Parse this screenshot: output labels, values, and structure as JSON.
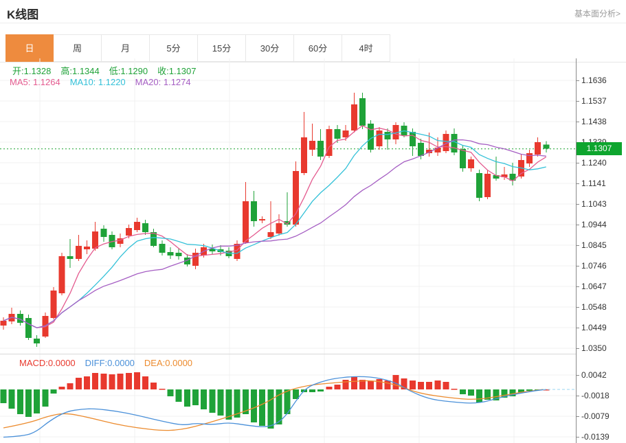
{
  "header": {
    "title": "K线图",
    "link": "基本面分析>"
  },
  "tabs": {
    "items": [
      {
        "label": "日",
        "selected": true
      },
      {
        "label": "周"
      },
      {
        "label": "月"
      },
      {
        "label": "5分"
      },
      {
        "label": "15分"
      },
      {
        "label": "30分"
      },
      {
        "label": "60分"
      },
      {
        "label": "4时"
      }
    ]
  },
  "legend": {
    "ohlc_items": [
      "开:1.1328",
      "高:1.1344",
      "低:1.1290",
      "收:1.1307"
    ],
    "ma_items": [
      "MA5: 1.1264",
      "MA10: 1.1220",
      "MA20: 1.1274"
    ],
    "macd_items": [
      "MACD:0.0000",
      "DIFF:0.0000",
      "DEA:0.0000"
    ]
  },
  "chart_data": {
    "type": "candlestick+macd",
    "main": {
      "y_ticks": [
        "1.1636",
        "1.1537",
        "1.1438",
        "1.1339",
        "1.1240",
        "1.1141",
        "1.1043",
        "1.0944",
        "1.0845",
        "1.0746",
        "1.0647",
        "1.0548",
        "1.0449",
        "1.0350"
      ],
      "current_price": "1.1307",
      "current_price_value": 1.1307,
      "candles_format": "o,h,l,c (red=up day, green=down day)",
      "candles": [
        [
          1.0458,
          1.0498,
          1.0438,
          1.0481
        ],
        [
          1.0478,
          1.0544,
          1.0464,
          1.0514
        ],
        [
          1.0514,
          1.053,
          1.0458,
          1.0471
        ],
        [
          1.0494,
          1.0511,
          1.0389,
          1.0398
        ],
        [
          1.0395,
          1.0412,
          1.0356,
          1.0372
        ],
        [
          1.0405,
          1.0521,
          1.0398,
          1.0504
        ],
        [
          1.0494,
          1.0643,
          1.0488,
          1.0626
        ],
        [
          1.0613,
          1.0808,
          1.0603,
          1.0791
        ],
        [
          1.0791,
          1.0874,
          1.0735,
          1.0778
        ],
        [
          1.0778,
          1.0894,
          1.0768,
          1.0841
        ],
        [
          1.0824,
          1.0867,
          1.0801,
          1.0837
        ],
        [
          1.0828,
          1.0956,
          1.0818,
          1.091
        ],
        [
          1.0923,
          1.094,
          1.0861,
          1.0884
        ],
        [
          1.0894,
          1.091,
          1.0824,
          1.0834
        ],
        [
          1.0851,
          1.09,
          1.0834,
          1.0877
        ],
        [
          1.089,
          1.0943,
          1.0877,
          1.0927
        ],
        [
          1.0917,
          1.0976,
          1.0907,
          1.0956
        ],
        [
          1.095,
          1.0966,
          1.0894,
          1.0907
        ],
        [
          1.0907,
          1.0923,
          1.0834,
          1.0841
        ],
        [
          1.0851,
          1.0867,
          1.0794,
          1.0808
        ],
        [
          1.0811,
          1.0834,
          1.0778,
          1.0794
        ],
        [
          1.0808,
          1.0828,
          1.0775,
          1.0791
        ],
        [
          1.0785,
          1.0801,
          1.0742,
          1.0752
        ],
        [
          1.0745,
          1.0828,
          1.0729,
          1.0808
        ],
        [
          1.0794,
          1.0851,
          1.0785,
          1.0834
        ],
        [
          1.0828,
          1.0847,
          1.0801,
          1.0814
        ],
        [
          1.0824,
          1.0844,
          1.0794,
          1.0811
        ],
        [
          1.0818,
          1.0834,
          1.0781,
          1.0791
        ],
        [
          1.0778,
          1.0867,
          1.0768,
          1.0851
        ],
        [
          1.0857,
          1.1148,
          1.0851,
          1.1055
        ],
        [
          1.1055,
          1.1105,
          1.0933,
          1.096
        ],
        [
          1.0963,
          1.0983,
          1.095,
          1.097
        ],
        [
          1.0884,
          1.1055,
          1.0874,
          1.0907
        ],
        [
          1.09,
          1.0993,
          1.089,
          1.095
        ],
        [
          1.096,
          1.1098,
          1.0933,
          1.0943
        ],
        [
          1.0943,
          1.1247,
          1.0933,
          1.12
        ],
        [
          1.1191,
          1.1484,
          1.1181,
          1.1362
        ],
        [
          1.1303,
          1.1428,
          1.1273,
          1.1346
        ],
        [
          1.1346,
          1.1402,
          1.1253,
          1.127
        ],
        [
          1.1273,
          1.1418,
          1.1263,
          1.1402
        ],
        [
          1.1402,
          1.1422,
          1.1336,
          1.1356
        ],
        [
          1.1362,
          1.1422,
          1.1346,
          1.1395
        ],
        [
          1.1395,
          1.1577,
          1.1385,
          1.1521
        ],
        [
          1.155,
          1.1577,
          1.1402,
          1.1418
        ],
        [
          1.1428,
          1.1445,
          1.129,
          1.1303
        ],
        [
          1.1319,
          1.1412,
          1.1303,
          1.1395
        ],
        [
          1.1389,
          1.1405,
          1.1303,
          1.1352
        ],
        [
          1.1352,
          1.1435,
          1.1329,
          1.1422
        ],
        [
          1.1418,
          1.1435,
          1.1362,
          1.1372
        ],
        [
          1.1389,
          1.1405,
          1.1273,
          1.1319
        ],
        [
          1.1336,
          1.1356,
          1.1257,
          1.1273
        ],
        [
          1.1286,
          1.1385,
          1.127,
          1.1303
        ],
        [
          1.129,
          1.1362,
          1.1273,
          1.1313
        ],
        [
          1.1296,
          1.1395,
          1.1286,
          1.1379
        ],
        [
          1.1379,
          1.1405,
          1.1276,
          1.129
        ],
        [
          1.1306,
          1.1323,
          1.1197,
          1.1214
        ],
        [
          1.1214,
          1.127,
          1.1197,
          1.1257
        ],
        [
          1.1191,
          1.1207,
          1.1055,
          1.1072
        ],
        [
          1.1075,
          1.1204,
          1.1065,
          1.1187
        ],
        [
          1.1181,
          1.127,
          1.1154,
          1.1164
        ],
        [
          1.1171,
          1.122,
          1.1158,
          1.1184
        ],
        [
          1.1187,
          1.124,
          1.1131,
          1.1154
        ],
        [
          1.1174,
          1.128,
          1.1164,
          1.1253
        ],
        [
          1.1237,
          1.1303,
          1.122,
          1.1286
        ],
        [
          1.128,
          1.1362,
          1.127,
          1.1339
        ],
        [
          1.1328,
          1.1344,
          1.129,
          1.1307
        ]
      ],
      "ma_windows": [
        5,
        10,
        20
      ]
    },
    "macd": {
      "y_ticks": [
        "0.0042",
        "-0.0018",
        "-0.0079",
        "-0.0139"
      ],
      "bars": [
        -0.004,
        -0.0056,
        -0.0072,
        -0.008,
        -0.007,
        -0.005,
        -0.0012,
        0.0008,
        0.0018,
        0.0034,
        0.0038,
        0.0048,
        0.0046,
        0.0044,
        0.0046,
        0.0048,
        0.005,
        0.0038,
        0.002,
        0.0002,
        -0.002,
        -0.0036,
        -0.005,
        -0.0046,
        -0.0058,
        -0.0068,
        -0.0076,
        -0.0088,
        -0.0082,
        -0.0072,
        -0.0096,
        -0.0106,
        -0.0114,
        -0.0102,
        -0.0072,
        -0.0028,
        -0.0008,
        -0.0008,
        -0.0006,
        0.0008,
        0.0014,
        0.0028,
        0.0038,
        0.0028,
        0.0024,
        0.003,
        0.0026,
        0.0042,
        0.0032,
        0.0026,
        0.0022,
        0.0022,
        0.0026,
        0.0022,
        0.0002,
        -0.0014,
        -0.0018,
        -0.0038,
        -0.003,
        -0.0032,
        -0.0024,
        -0.002,
        -0.001,
        -0.0004,
        -0.0002,
        0.0
      ],
      "diff_line": [
        [
          0,
          -0.0139
        ],
        [
          2.5,
          -0.0136
        ],
        [
          4,
          -0.0122
        ],
        [
          5.5,
          -0.0092
        ],
        [
          7.5,
          -0.0064
        ],
        [
          9.5,
          -0.0057
        ],
        [
          11,
          -0.0056
        ],
        [
          13.5,
          -0.0063
        ],
        [
          16,
          -0.0075
        ],
        [
          18.5,
          -0.009
        ],
        [
          21.5,
          -0.0105
        ],
        [
          23,
          -0.0098
        ],
        [
          25,
          -0.0103
        ],
        [
          27,
          -0.0096
        ],
        [
          29.3,
          -0.0105
        ],
        [
          31.3,
          -0.011
        ],
        [
          32.6,
          -0.0102
        ],
        [
          33.8,
          -0.0078
        ],
        [
          35,
          -0.0034
        ],
        [
          36.3,
          0.0006
        ],
        [
          38,
          0.0022
        ],
        [
          39.6,
          0.0032
        ],
        [
          42,
          0.0038
        ],
        [
          44.5,
          0.0036
        ],
        [
          47,
          0.002
        ],
        [
          48.6,
          -0.0004
        ],
        [
          51,
          -0.0028
        ],
        [
          53.5,
          -0.0036
        ],
        [
          56.8,
          -0.0042
        ],
        [
          59.7,
          -0.0022
        ],
        [
          61.7,
          -0.0012
        ],
        [
          63.8,
          -0.0003
        ],
        [
          65,
          0.0
        ]
      ],
      "dea_line": [
        [
          0,
          -0.0112
        ],
        [
          3,
          -0.0098
        ],
        [
          5.3,
          -0.0078
        ],
        [
          7.4,
          -0.0068
        ],
        [
          10.3,
          -0.0082
        ],
        [
          13.2,
          -0.01
        ],
        [
          16,
          -0.0112
        ],
        [
          19,
          -0.012
        ],
        [
          21,
          -0.0118
        ],
        [
          23,
          -0.0108
        ],
        [
          26.7,
          -0.0082
        ],
        [
          31,
          -0.0046
        ],
        [
          33.6,
          -0.0006
        ],
        [
          36.4,
          0.0012
        ],
        [
          39,
          0.0018
        ],
        [
          42,
          0.0024
        ],
        [
          44.5,
          0.0026
        ],
        [
          47.3,
          0.0012
        ],
        [
          49.8,
          -0.0012
        ],
        [
          54,
          -0.0026
        ],
        [
          56.6,
          -0.003
        ],
        [
          59.4,
          -0.002
        ],
        [
          62,
          -0.0008
        ],
        [
          64.7,
          0.0
        ]
      ],
      "projection_level": 0.0
    },
    "colors": {
      "up": "#e8392e",
      "down": "#1fa238",
      "ma5": "#e45b8f",
      "ma10": "#33c1d8",
      "ma20": "#a55ec3",
      "diff": "#4a90d9",
      "dea": "#ec8b2e",
      "tag_bg": "#0ea52e",
      "dotted": "#18a12f",
      "accent": "#ee8b3e",
      "grid": "#f0f0f0",
      "axis": "#8a8a8a",
      "projection_dash": "#9ad4f2"
    }
  }
}
